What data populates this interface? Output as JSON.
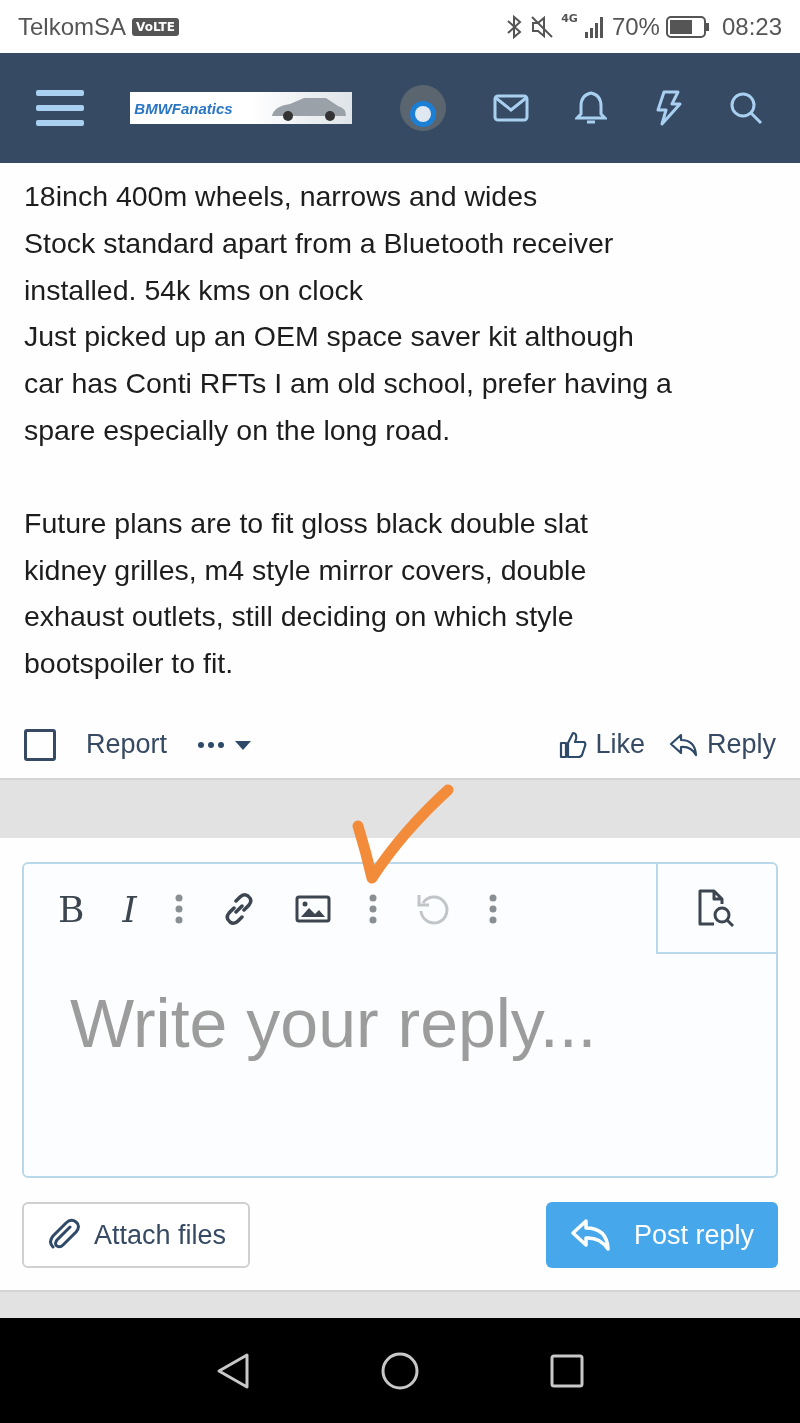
{
  "status_bar": {
    "carrier": "TelkomSA",
    "volte": "VoLTE",
    "network": "4G",
    "battery": "70%",
    "time": "08:23"
  },
  "header": {
    "logo": "BMWFanatics"
  },
  "post": {
    "paragraphs": [
      [
        "18inch 400m wheels, narrows and wides",
        "Stock standard apart from a Bluetooth receiver",
        "installed. 54k kms on clock",
        "Just picked up an OEM space saver kit although",
        "car has Conti RFTs I am old school, prefer having a",
        "spare especially on the long road."
      ],
      [
        "Future plans are to fit gloss black double slat",
        "kidney grilles, m4 style mirror covers, double",
        "exhaust outlets, still deciding on which style",
        "bootspoiler to fit."
      ]
    ],
    "select_checked": false,
    "report": "Report",
    "like": "Like",
    "reply": "Reply"
  },
  "editor": {
    "tools": [
      {
        "kind": "bold",
        "label": "B",
        "disabled": false
      },
      {
        "kind": "italic",
        "label": "I",
        "disabled": false
      },
      {
        "kind": "more",
        "disabled": false
      },
      {
        "kind": "link",
        "disabled": false
      },
      {
        "kind": "image",
        "disabled": false
      },
      {
        "kind": "more",
        "disabled": false
      },
      {
        "kind": "undo",
        "disabled": true
      },
      {
        "kind": "more",
        "disabled": false
      }
    ],
    "placeholder": "Write your reply...",
    "attach": "Attach files",
    "post": "Post reply"
  }
}
